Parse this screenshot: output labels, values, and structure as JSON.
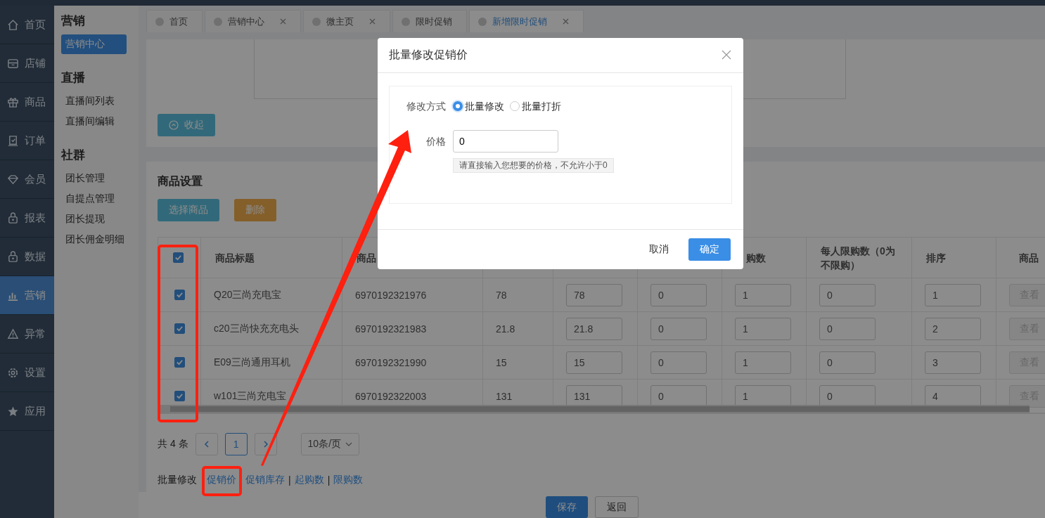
{
  "nav": [
    {
      "label": "首页",
      "selected": false
    },
    {
      "label": "店铺",
      "selected": false
    },
    {
      "label": "商品",
      "selected": false
    },
    {
      "label": "订单",
      "selected": false
    },
    {
      "label": "会员",
      "selected": false
    },
    {
      "label": "报表",
      "selected": false
    },
    {
      "label": "数据",
      "selected": false
    },
    {
      "label": "营销",
      "selected": true
    },
    {
      "label": "异常",
      "selected": false
    },
    {
      "label": "设置",
      "selected": false
    },
    {
      "label": "应用",
      "selected": false
    }
  ],
  "sidebar": {
    "sections": [
      {
        "title": "营销",
        "items": [
          {
            "label": "营销中心",
            "selected": true
          }
        ]
      },
      {
        "title": "直播",
        "items": [
          {
            "label": "直播间列表",
            "selected": false
          },
          {
            "label": "直播间编辑",
            "selected": false
          }
        ]
      },
      {
        "title": "社群",
        "items": [
          {
            "label": "团长管理",
            "selected": false
          },
          {
            "label": "自提点管理",
            "selected": false
          },
          {
            "label": "团长提现",
            "selected": false
          },
          {
            "label": "团长佣金明细",
            "selected": false
          }
        ]
      }
    ]
  },
  "tabs": [
    {
      "label": "首页",
      "selected": false,
      "closable": false
    },
    {
      "label": "营销中心",
      "selected": false,
      "closable": true
    },
    {
      "label": "微主页",
      "selected": false,
      "closable": true
    },
    {
      "label": "限时促销",
      "selected": false,
      "closable": false
    },
    {
      "label": "新增限时促销",
      "selected": true,
      "closable": true
    }
  ],
  "collapse_button": "收起",
  "product_settings": {
    "title": "商品设置",
    "buttons": [
      {
        "label": "选择商品",
        "kind": "info"
      },
      {
        "label": "删除",
        "kind": "warning"
      }
    ],
    "table": {
      "header_checked": true,
      "columns": [
        {
          "kind": "check"
        },
        {
          "label": "商品标题"
        },
        {
          "label": "商品"
        },
        {},
        {},
        {},
        {
          "label": "购数"
        },
        {
          "label": "每人限购数（0为不限购）"
        },
        {
          "label": "排序"
        },
        {
          "label": "商品"
        }
      ],
      "rows": [
        {
          "checked": true,
          "title": "Q20三尚充电宝",
          "code": "6970192321976",
          "price": "78",
          "promo_price": "78",
          "promo_stock": "0",
          "min_buy": "1",
          "limit": "0",
          "sort": "1",
          "link_button": "查看"
        },
        {
          "checked": true,
          "title": "c20三尚快充充电头",
          "code": "6970192321983",
          "price": "21.8",
          "promo_price": "21.8",
          "promo_stock": "0",
          "min_buy": "1",
          "limit": "0",
          "sort": "2",
          "link_button": "查看"
        },
        {
          "checked": true,
          "title": "E09三尚通用耳机",
          "code": "6970192321990",
          "price": "15",
          "promo_price": "15",
          "promo_stock": "0",
          "min_buy": "1",
          "limit": "0",
          "sort": "3",
          "link_button": "查看"
        },
        {
          "checked": true,
          "title": "w101三尚充电宝",
          "code": "6970192322003",
          "price": "131",
          "promo_price": "131",
          "promo_stock": "0",
          "min_buy": "1",
          "limit": "0",
          "sort": "4",
          "link_button": "查看"
        }
      ]
    },
    "pagination": {
      "total": "共 4 条",
      "pages": [
        {
          "label": "1",
          "selected": true
        }
      ],
      "page_size": "10条/页"
    },
    "batch": {
      "label": "批量修改",
      "items": [
        {
          "kind": "link",
          "text": "促销价"
        },
        {
          "kind": "link",
          "text": "促销库存"
        },
        {
          "kind": "separator",
          "text": "|"
        },
        {
          "kind": "link",
          "text": "起购数"
        },
        {
          "kind": "separator",
          "text": "|"
        },
        {
          "kind": "link",
          "text": "限购数"
        }
      ]
    }
  },
  "footer_buttons": [
    {
      "label": "保存",
      "kind": "primary"
    },
    {
      "label": "返回",
      "kind": "default"
    }
  ],
  "dialog": {
    "title": "批量修改促销价",
    "mode_label": "修改方式",
    "modes": [
      {
        "label": "批量修改",
        "selected": true
      },
      {
        "label": "批量打折",
        "selected": false
      }
    ],
    "price_label": "价格",
    "price_value": "0",
    "hint": "请直接输入您想要的价格，不允许小于0",
    "buttons": [
      {
        "label": "取消",
        "kind": "default"
      },
      {
        "label": "确定",
        "kind": "primary"
      }
    ]
  }
}
